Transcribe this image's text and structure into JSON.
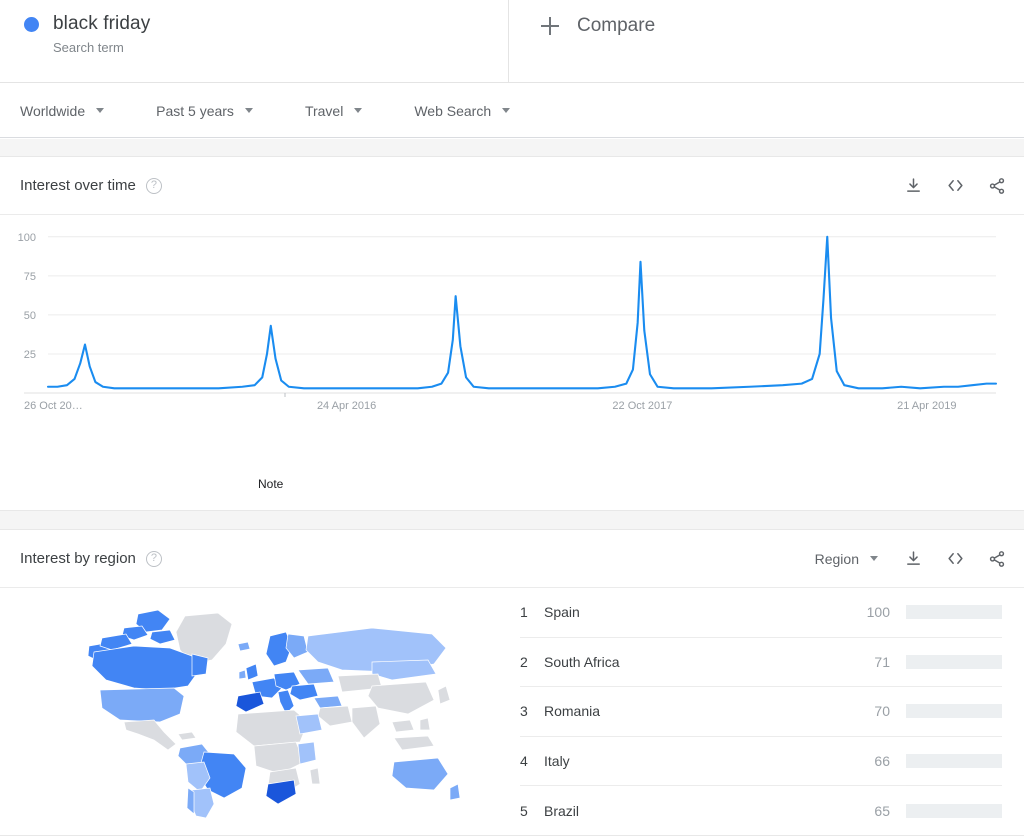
{
  "term": {
    "name": "black friday",
    "type_label": "Search term",
    "dot_color": "#4285f4"
  },
  "compare": {
    "label": "Compare",
    "icon": "plus-icon"
  },
  "filters": [
    {
      "label": "Worldwide",
      "icon": "chevron-down-icon"
    },
    {
      "label": "Past 5 years",
      "icon": "chevron-down-icon"
    },
    {
      "label": "Travel",
      "icon": "chevron-down-icon"
    },
    {
      "label": "Web Search",
      "icon": "chevron-down-icon"
    }
  ],
  "interest_over_time": {
    "title": "Interest over time",
    "help_icon": "help-circle-icon",
    "actions": [
      {
        "name": "download-icon",
        "label": "Download"
      },
      {
        "name": "embed-code-icon",
        "label": "Embed"
      },
      {
        "name": "share-icon",
        "label": "Share"
      }
    ],
    "note_label": "Note"
  },
  "interest_by_region": {
    "title": "Interest by region",
    "help_icon": "help-circle-icon",
    "selector": {
      "label": "Region",
      "icon": "chevron-down-icon"
    },
    "actions": [
      {
        "name": "download-icon",
        "label": "Download"
      },
      {
        "name": "embed-code-icon",
        "label": "Embed"
      },
      {
        "name": "share-icon",
        "label": "Share"
      }
    ],
    "rows": [
      {
        "rank": "1",
        "name": "Spain",
        "value": "100",
        "pct": 100
      },
      {
        "rank": "2",
        "name": "South Africa",
        "value": "71",
        "pct": 71
      },
      {
        "rank": "3",
        "name": "Romania",
        "value": "70",
        "pct": 70
      },
      {
        "rank": "4",
        "name": "Italy",
        "value": "66",
        "pct": 66
      },
      {
        "rank": "5",
        "name": "Brazil",
        "value": "65",
        "pct": 65
      }
    ]
  },
  "colors": {
    "accent": "#4285f4",
    "line": "#1a8cf0",
    "bar_track": "#eceff1",
    "map_no_data": "#dadce0",
    "page_gap": "#f5f5f5"
  },
  "chart_data": {
    "type": "line",
    "title": "Interest over time",
    "xlabel": "",
    "ylabel": "",
    "ylim": [
      0,
      105
    ],
    "grid": true,
    "legend": false,
    "ytick_labels": [
      "100",
      "75",
      "50",
      "25"
    ],
    "ytick_values": [
      100,
      75,
      50,
      25
    ],
    "xtick_labels": [
      "26 Oct 20…",
      "24 Apr 2016",
      "22 Oct 2017",
      "21 Apr 2019"
    ],
    "xtick_positions": [
      0.0,
      0.315,
      0.627,
      0.927
    ],
    "annotations": [
      {
        "text": "Note",
        "x": 0.25,
        "y": 4
      }
    ],
    "series": [
      {
        "name": "black friday",
        "color": "#1a8cf0",
        "peaks": [
          {
            "x": 0.039,
            "value": 31
          },
          {
            "x": 0.235,
            "value": 43
          },
          {
            "x": 0.43,
            "value": 62
          },
          {
            "x": 0.625,
            "value": 84
          },
          {
            "x": 0.822,
            "value": 100
          }
        ],
        "baseline": 3,
        "points": [
          [
            0.0,
            4
          ],
          [
            0.01,
            4
          ],
          [
            0.02,
            5
          ],
          [
            0.028,
            9
          ],
          [
            0.034,
            19
          ],
          [
            0.039,
            31
          ],
          [
            0.044,
            17
          ],
          [
            0.05,
            7
          ],
          [
            0.058,
            4
          ],
          [
            0.07,
            3
          ],
          [
            0.1,
            3
          ],
          [
            0.14,
            3
          ],
          [
            0.18,
            3
          ],
          [
            0.205,
            4
          ],
          [
            0.218,
            5
          ],
          [
            0.226,
            10
          ],
          [
            0.231,
            25
          ],
          [
            0.235,
            43
          ],
          [
            0.24,
            22
          ],
          [
            0.246,
            8
          ],
          [
            0.254,
            4
          ],
          [
            0.27,
            3
          ],
          [
            0.31,
            3
          ],
          [
            0.35,
            3
          ],
          [
            0.39,
            3
          ],
          [
            0.405,
            4
          ],
          [
            0.415,
            6
          ],
          [
            0.422,
            13
          ],
          [
            0.427,
            34
          ],
          [
            0.43,
            62
          ],
          [
            0.435,
            30
          ],
          [
            0.441,
            10
          ],
          [
            0.449,
            4
          ],
          [
            0.465,
            3
          ],
          [
            0.5,
            3
          ],
          [
            0.54,
            3
          ],
          [
            0.58,
            3
          ],
          [
            0.598,
            4
          ],
          [
            0.61,
            6
          ],
          [
            0.617,
            15
          ],
          [
            0.622,
            45
          ],
          [
            0.625,
            84
          ],
          [
            0.629,
            40
          ],
          [
            0.635,
            12
          ],
          [
            0.643,
            4
          ],
          [
            0.66,
            3
          ],
          [
            0.7,
            3
          ],
          [
            0.74,
            4
          ],
          [
            0.775,
            5
          ],
          [
            0.795,
            6
          ],
          [
            0.806,
            9
          ],
          [
            0.814,
            25
          ],
          [
            0.818,
            60
          ],
          [
            0.822,
            100
          ],
          [
            0.826,
            48
          ],
          [
            0.832,
            14
          ],
          [
            0.84,
            5
          ],
          [
            0.855,
            3
          ],
          [
            0.88,
            3
          ],
          [
            0.9,
            4
          ],
          [
            0.92,
            3
          ],
          [
            0.945,
            4
          ],
          [
            0.96,
            4
          ],
          [
            0.975,
            5
          ],
          [
            0.99,
            6
          ],
          [
            1.0,
            6
          ]
        ]
      }
    ]
  },
  "map_data": {
    "type": "choropleth",
    "no_data_color": "#dadce0",
    "scale": [
      "#e8f0fe",
      "#c6dafc",
      "#a1c2fa",
      "#7baaf7",
      "#4285f4",
      "#1a56db"
    ],
    "highlights": [
      {
        "region": "Spain",
        "level": 5
      },
      {
        "region": "South Africa",
        "level": 5
      },
      {
        "region": "Romania",
        "level": 4
      },
      {
        "region": "Italy",
        "level": 4
      },
      {
        "region": "Brazil",
        "level": 4
      },
      {
        "region": "Canada",
        "level": 4
      },
      {
        "region": "United States",
        "level": 3
      },
      {
        "region": "Russia",
        "level": 2
      },
      {
        "region": "Australia",
        "level": 3
      }
    ]
  }
}
